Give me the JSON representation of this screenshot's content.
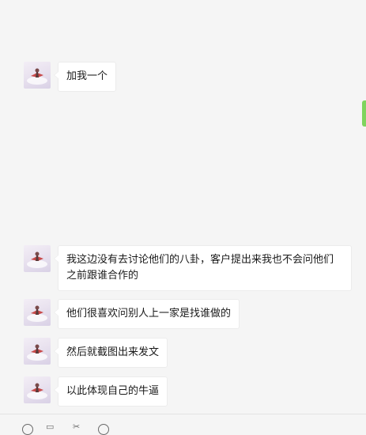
{
  "messages": [
    {
      "text": "加我一个"
    },
    {
      "text": "我这边没有去讨论他们的八卦，客户提出来我也不会问他们之前跟谁合作的"
    },
    {
      "text": "他们很喜欢问别人上一家是找谁做的"
    },
    {
      "text": "然后就截图出来发文"
    },
    {
      "text": "以此体现自己的牛逼"
    }
  ],
  "toolbar": {
    "icons": [
      "emoji-icon",
      "folder-icon",
      "scissors-icon",
      "chat-history-icon"
    ]
  },
  "colors": {
    "background": "#f5f5f5",
    "bubble": "#ffffff",
    "scroll_accent": "#7fd45e"
  }
}
